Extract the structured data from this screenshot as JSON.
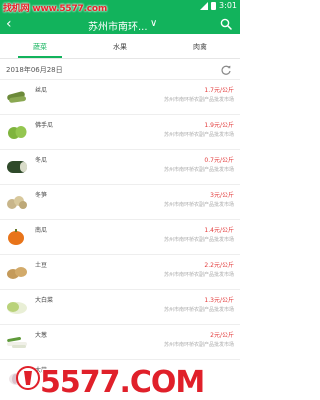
{
  "status_bar": {
    "watermark": "找机网 www.5577.com",
    "time": "3:01",
    "signal_icon": "signal-icon",
    "battery_icon": "battery-icon"
  },
  "header": {
    "back_icon": "back-arrow-icon",
    "city": "苏州市南环...",
    "dropdown_icon": "chevron-down-icon",
    "search_icon": "search-icon"
  },
  "tabs": [
    {
      "label": "蔬菜",
      "active": true
    },
    {
      "label": "水果",
      "active": false
    },
    {
      "label": "肉禽",
      "active": false
    }
  ],
  "date": "2018年06月28日",
  "refresh_icon": "refresh-icon",
  "items": [
    {
      "name": "丝瓜",
      "price": "1.7元/公斤",
      "market": "苏州市南环桥农副产品批发市场"
    },
    {
      "name": "佛手瓜",
      "price": "1.9元/公斤",
      "market": "苏州市南环桥农副产品批发市场"
    },
    {
      "name": "冬瓜",
      "price": "0.7元/公斤",
      "market": "苏州市南环桥农副产品批发市场"
    },
    {
      "name": "冬笋",
      "price": "3元/公斤",
      "market": "苏州市南环桥农副产品批发市场"
    },
    {
      "name": "南瓜",
      "price": "1.4元/公斤",
      "market": "苏州市南环桥农副产品批发市场"
    },
    {
      "name": "土豆",
      "price": "2.2元/公斤",
      "market": "苏州市南环桥农副产品批发市场"
    },
    {
      "name": "大白菜",
      "price": "1.3元/公斤",
      "market": "苏州市南环桥农副产品批发市场"
    },
    {
      "name": "大葱",
      "price": "2元/公斤",
      "market": "苏州市南环桥农副产品批发市场"
    },
    {
      "name": "大蒜",
      "price": "",
      "market": ""
    }
  ],
  "watermark_big": "5577.COM",
  "colors": {
    "brand": "#12b35c",
    "price": "#e23a3a",
    "watermark": "#e0202a"
  }
}
